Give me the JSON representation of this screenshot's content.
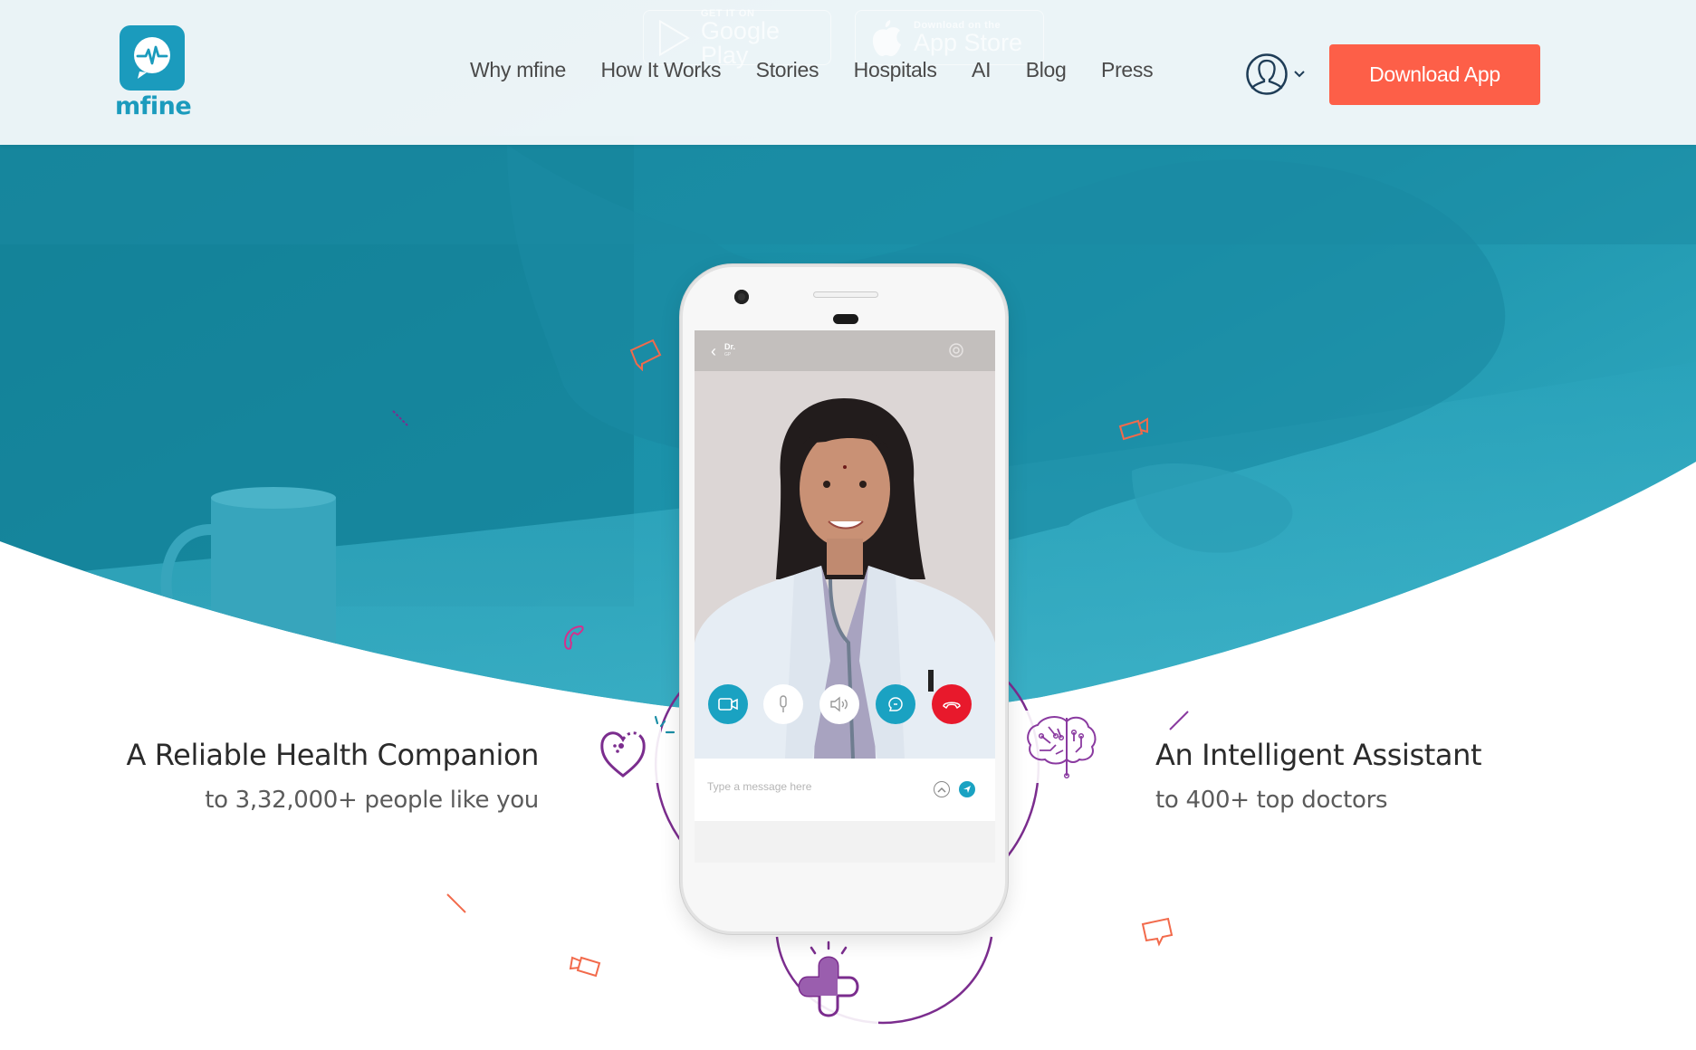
{
  "brand": {
    "name": "mfine",
    "logo_icon": "heartbeat-chat-icon",
    "color": "#1b9bbd"
  },
  "store_badges": [
    {
      "small": "GET IT ON",
      "big": "Google Play",
      "icon": "google-play-icon"
    },
    {
      "small": "Download on the",
      "big": "App Store",
      "icon": "apple-icon"
    }
  ],
  "nav": {
    "items": [
      {
        "label": "Why mfine"
      },
      {
        "label": "How It Works"
      },
      {
        "label": "Stories"
      },
      {
        "label": "Hospitals"
      },
      {
        "label": "AI"
      },
      {
        "label": "Blog"
      },
      {
        "label": "Press"
      }
    ],
    "user_icon": "user-avatar-icon",
    "dropdown_icon": "chevron-down-icon",
    "download_label": "Download App",
    "download_color": "#fd5f48"
  },
  "phone": {
    "header_title": "Dr.",
    "header_subtitle": "GP",
    "call_controls": [
      {
        "name": "video",
        "icon": "video-camera-icon",
        "color": "#1aa2c2"
      },
      {
        "name": "mute",
        "icon": "microphone-icon",
        "color": "#ffffff"
      },
      {
        "name": "speaker",
        "icon": "speaker-icon",
        "color": "#ffffff"
      },
      {
        "name": "chat",
        "icon": "chat-bubble-icon",
        "color": "#1aa2c2"
      },
      {
        "name": "end-call",
        "icon": "hang-up-icon",
        "color": "#e8192c"
      }
    ],
    "message_placeholder": "Type a message here"
  },
  "features": {
    "left": {
      "title": "A Reliable Health Companion",
      "subtitle": "to 3,32,000+ people like you",
      "icon": "heart-icon"
    },
    "right": {
      "title": "An Intelligent Assistant",
      "subtitle": "to 400+ top doctors",
      "icon": "brain-circuit-icon"
    },
    "bottom": {
      "icon": "medical-cross-icon"
    }
  },
  "colors": {
    "hero_teal": "#1a8ea6",
    "accent_purple": "#7b2d8e",
    "accent_orange": "#f26a4b"
  }
}
